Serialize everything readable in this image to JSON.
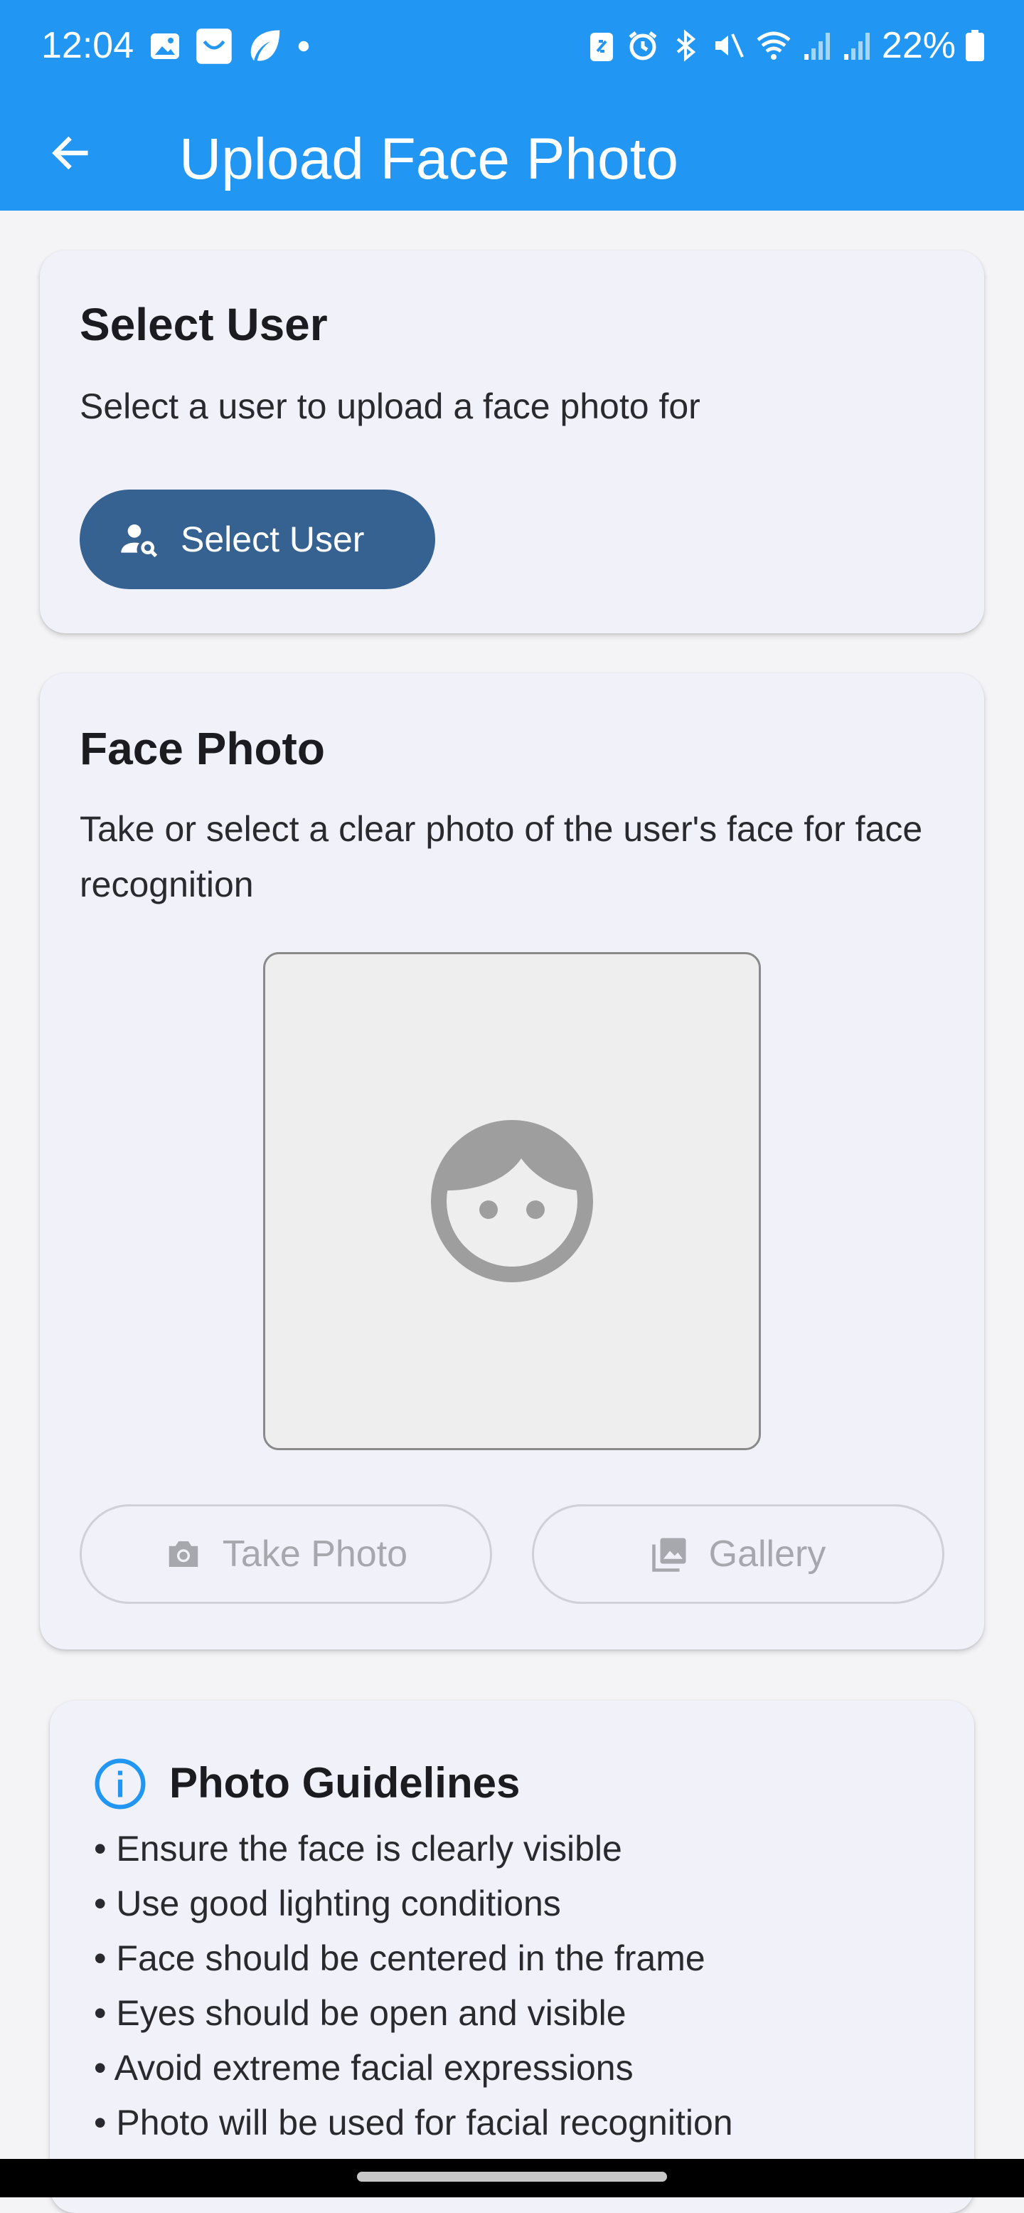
{
  "status_bar": {
    "time": "12:04",
    "battery_percent": "22%"
  },
  "app_bar": {
    "title": "Upload Face Photo"
  },
  "select_user_card": {
    "title": "Select User",
    "description": "Select a user to upload a face photo for",
    "button_label": "Select User"
  },
  "face_photo_card": {
    "title": "Face Photo",
    "description": "Take or select a clear photo of the user's face for face recognition",
    "take_photo_label": "Take Photo",
    "gallery_label": "Gallery"
  },
  "guidelines_card": {
    "title": "Photo Guidelines",
    "items": [
      "• Ensure the face is clearly visible",
      "• Use good lighting conditions",
      "• Face should be centered in the frame",
      "• Eyes should be open and visible",
      "• Avoid extreme facial expressions",
      "• Photo will be used for facial recognition"
    ]
  },
  "colors": {
    "app_bar": "#2196f3",
    "primary_button": "#366291",
    "card_background": "#f0f1f9",
    "info_icon": "#2196f3"
  }
}
